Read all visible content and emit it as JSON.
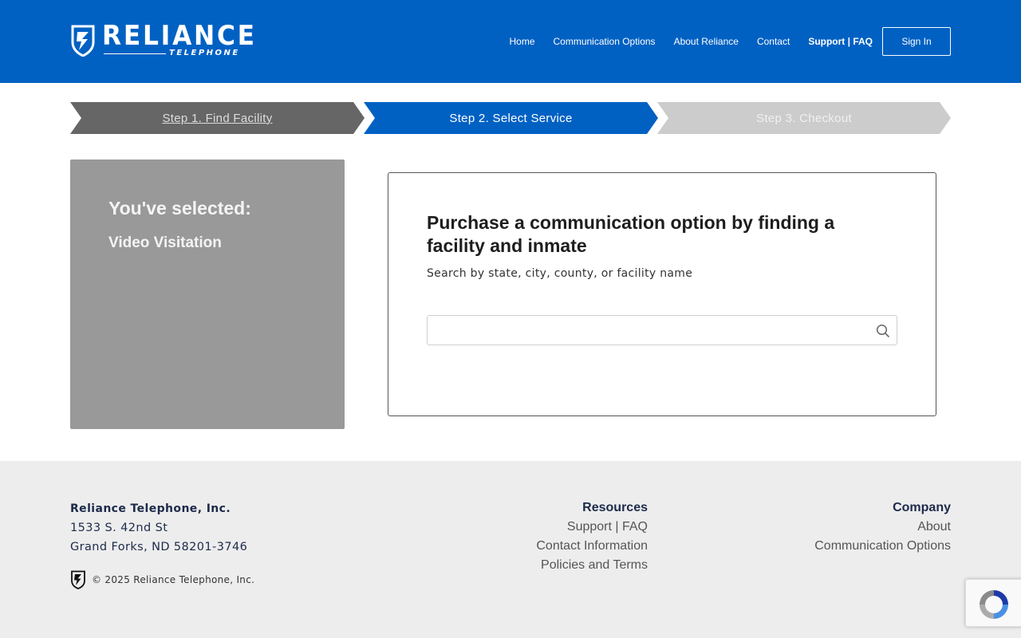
{
  "brand": {
    "name": "RELIANCE",
    "tagline": "TELEPHONE"
  },
  "nav": {
    "items": [
      "Home",
      "Communication Options",
      "About Reliance",
      "Contact"
    ],
    "support_label": "Support | FAQ",
    "signin_label": "Sign In"
  },
  "steps": [
    {
      "label": "Step 1. Find Facility",
      "state": "completed"
    },
    {
      "label": "Step 2. Select Service",
      "state": "active"
    },
    {
      "label": "Step 3. Checkout",
      "state": "upcoming"
    }
  ],
  "selected": {
    "title": "You've selected:",
    "value": "Video Visitation"
  },
  "search_card": {
    "title": "Purchase a communication option by finding a facility and inmate",
    "subtitle": "Search by state, city, county, or facility name",
    "input_value": "",
    "placeholder": ""
  },
  "footer": {
    "company_name": "Reliance Telephone, Inc.",
    "address_line1": "1533 S. 42nd St",
    "address_line2": "Grand Forks, ND 58201-3746",
    "copyright": "© 2025 Reliance Telephone, Inc.",
    "resources": {
      "heading": "Resources",
      "links": [
        "Support | FAQ",
        "Contact Information",
        "Policies and Terms"
      ]
    },
    "company": {
      "heading": "Company",
      "links": [
        "About",
        "Communication Options"
      ]
    }
  },
  "colors": {
    "primary": "#0061c3",
    "step_completed": "#666666",
    "step_upcoming": "#cccccc",
    "panel_gray": "#999999",
    "footer_bg": "#ededed",
    "footer_text": "#1d2a4a"
  },
  "icons": [
    "reliance-shield-icon",
    "search-icon",
    "recaptcha-icon"
  ]
}
